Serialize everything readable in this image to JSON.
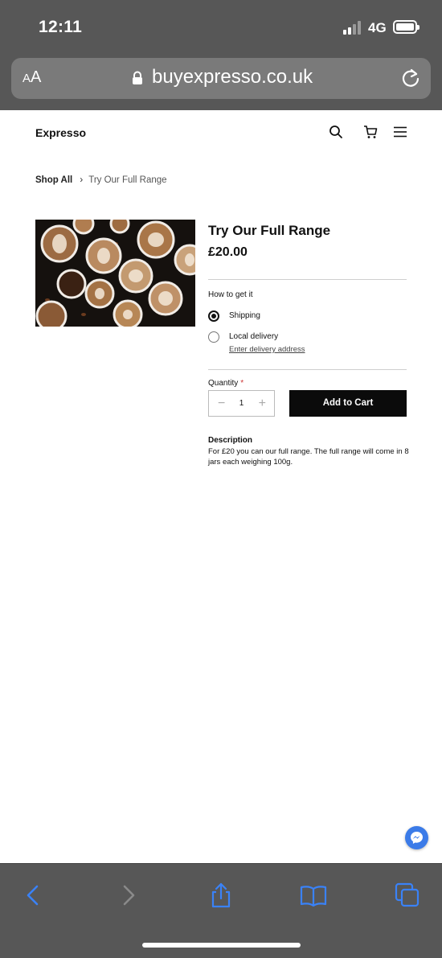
{
  "status_bar": {
    "time": "12:11",
    "network": "4G"
  },
  "browser": {
    "text_size_label": "A",
    "text_size_label_large": "A",
    "url": "buyexpresso.co.uk"
  },
  "site": {
    "brand": "Expresso"
  },
  "breadcrumb": {
    "root": "Shop All",
    "separator": "›",
    "current": "Try Our Full Range"
  },
  "product": {
    "title": "Try Our Full Range",
    "price": "£20.00",
    "fulfillment_label": "How to get it",
    "options": [
      {
        "label": "Shipping",
        "selected": true
      },
      {
        "label": "Local delivery",
        "selected": false
      }
    ],
    "delivery_link": "Enter delivery address",
    "quantity_label": "Quantity",
    "required_marker": "*",
    "quantity": "1",
    "add_to_cart": "Add to Cart",
    "description_title": "Description",
    "description": "For £20 you can our full range. The full range will come in 8 jars each weighing 100g."
  },
  "colors": {
    "accent": "#0b0b0b",
    "browser_chrome": "#575757",
    "ios_link": "#3a82f7",
    "messenger": "#3b7be8"
  }
}
